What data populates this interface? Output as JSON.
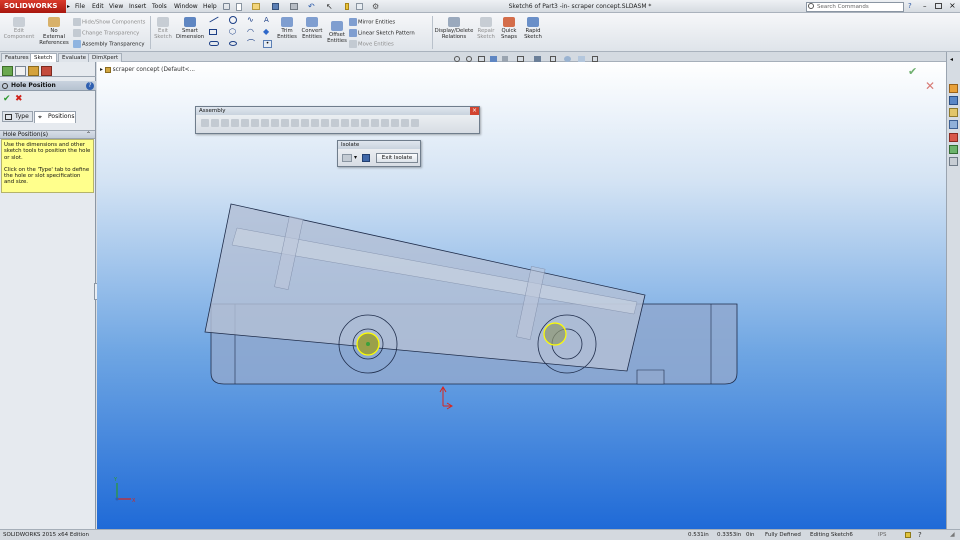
{
  "app": {
    "logo_text": "SOLIDWORKS",
    "doc_title": "Sketch6 of Part3 -in- scraper concept.SLDASM *"
  },
  "menu": [
    "File",
    "Edit",
    "View",
    "Insert",
    "Tools",
    "Window",
    "Help"
  ],
  "search": {
    "placeholder": "Search Commands"
  },
  "ribbon": {
    "edit_component": "Edit\nComponent",
    "no_external_references": "No\nExternal\nReferences",
    "hide_show_components": "Hide/Show Components",
    "change_transparency": "Change Transparency",
    "assembly_transparency": "Assembly Transparency",
    "exit_sketch": "Exit\nSketch",
    "smart_dimension": "Smart\nDimension",
    "trim_entities": "Trim\nEntities",
    "convert_entities": "Convert\nEntities",
    "offset_entities": "Offset\nEntities",
    "mirror_entities": "Mirror Entities",
    "linear_sketch_pattern": "Linear Sketch Pattern",
    "move_entities": "Move Entities",
    "display_delete_relations": "Display/Delete\nRelations",
    "repair_sketch": "Repair\nSketch",
    "quick_snaps": "Quick\nSnaps",
    "rapid_sketch": "Rapid\nSketch"
  },
  "cm_tabs": [
    "Features",
    "Sketch",
    "Evaluate",
    "DimXpert"
  ],
  "panel": {
    "title": "Hole Position",
    "tab_type": "Type",
    "tab_positions": "Positions",
    "section_title": "Hole Position(s)",
    "help_text_1": "Use the dimensions and other sketch tools to position the hole or slot.",
    "help_text_2": "Click on the 'Type' tab to define the hole or slot specification and size."
  },
  "tree": {
    "item": "scraper concept  (Default<..."
  },
  "assembly_toolbar": {
    "title": "Assembly"
  },
  "isolate_toolbar": {
    "title": "Isolate",
    "exit_label": "Exit Isolate"
  },
  "status": {
    "edition": "SOLIDWORKS 2015 x64 Edition",
    "x": "0.531in",
    "y": "0.3353in",
    "z": "0in",
    "state": "Fully Defined",
    "editing": "Editing Sketch6",
    "units": "IPS"
  },
  "colors": {
    "accent": "#cf2a1c",
    "viewport_bottom": "#1f6ad7",
    "part_body": "#a9b8d4",
    "hole_highlight": "#ffff00"
  }
}
